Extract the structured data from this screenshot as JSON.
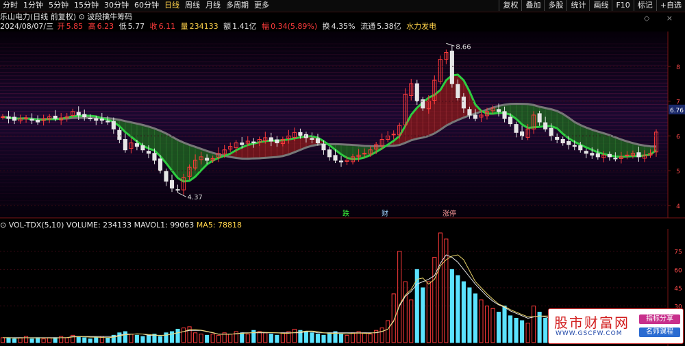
{
  "toolbar": {
    "tabs": [
      "分时",
      "1分钟",
      "5分钟",
      "15分钟",
      "30分钟",
      "60分钟",
      "日线",
      "周线",
      "月线",
      "多周期",
      "更多"
    ],
    "active_index": 6,
    "right_buttons": [
      "复权",
      "叠加",
      "多股",
      "统计",
      "画线",
      "F10",
      "标记",
      "+自选"
    ]
  },
  "header": {
    "stock_title": "乐山电力(日线 前复权)",
    "indicator_name": "波段擒牛筹码"
  },
  "quote": {
    "date": "2024/08/07/三",
    "open_label": "开",
    "open": "5.85",
    "high_label": "高",
    "high": "6.23",
    "low_label": "低",
    "low": "5.77",
    "close_label": "收",
    "close": "6.11",
    "volume_label": "量",
    "volume": "234133",
    "amount_label": "额",
    "amount": "1.41亿",
    "change_label": "幅",
    "change": "0.34(5.89%)",
    "turnover_label": "换",
    "turnover": "4.35%",
    "float_label": "流通",
    "float_value": "5.38亿",
    "sector": "水力发电"
  },
  "volume_header": {
    "name": "VOL-TDX(5,10)",
    "volume": "VOLUME: 234133",
    "mavol1": "MAVOL1: 99063",
    "ma5": "MA5: 78818"
  },
  "annotations": {
    "high_label": "8.66",
    "low_label": "4.37",
    "current_price_tag": "6.76",
    "events": [
      "跌",
      "财",
      "涨停"
    ]
  },
  "price_axis_ticks": [
    "8",
    "7",
    "6",
    "5",
    "4"
  ],
  "volume_axis_ticks": [
    "75",
    "60",
    "45",
    "30"
  ],
  "watermark": {
    "site": "股市财富网",
    "url": "WWW.GSCFW.COM",
    "tag1": "指标分享",
    "tag2": "名师课程"
  },
  "colors": {
    "up": "#ff3b3b",
    "down": "#5be3ff",
    "green_band": "#2ecc40",
    "red_band": "#d93030",
    "ma_yellow": "#e8d36a",
    "ma_white": "#e6e6e6"
  },
  "chart_data": {
    "type": "candlestick",
    "price_range": [
      4.0,
      9.0
    ],
    "high": 8.66,
    "low": 4.37,
    "last_close": 6.11,
    "close_series": [
      6.55,
      6.5,
      6.45,
      6.5,
      6.52,
      6.45,
      6.4,
      6.5,
      6.55,
      6.5,
      6.52,
      6.55,
      6.7,
      6.6,
      6.55,
      6.5,
      6.45,
      6.45,
      6.4,
      6.2,
      5.9,
      5.6,
      5.8,
      5.7,
      5.6,
      5.5,
      5.3,
      5.0,
      4.7,
      4.5,
      4.45,
      4.8,
      5.1,
      5.3,
      5.4,
      5.3,
      5.35,
      5.5,
      5.6,
      5.7,
      5.8,
      5.75,
      5.85,
      5.8,
      5.9,
      5.95,
      5.85,
      5.8,
      5.9,
      6.0,
      6.1,
      6.0,
      5.95,
      5.9,
      5.8,
      5.6,
      5.4,
      5.3,
      5.25,
      5.3,
      5.4,
      5.45,
      5.5,
      5.6,
      5.75,
      5.9,
      6.0,
      6.05,
      6.3,
      7.2,
      7.5,
      7.0,
      6.8,
      7.0,
      7.6,
      8.2,
      8.4,
      7.5,
      7.1,
      6.8,
      6.6,
      6.5,
      6.6,
      6.7,
      6.8,
      6.7,
      6.5,
      6.35,
      6.1,
      6.0,
      6.2,
      6.6,
      6.4,
      6.2,
      6.0,
      5.9,
      5.8,
      5.75,
      5.7,
      5.6,
      5.5,
      5.45,
      5.4,
      5.45,
      5.4,
      5.35,
      5.4,
      5.45,
      5.5,
      5.4,
      5.45,
      5.5,
      6.11
    ],
    "volume_series_wan": [
      4,
      4,
      3,
      4,
      5,
      3,
      4,
      3,
      4,
      4,
      5,
      4,
      6,
      5,
      4,
      3,
      4,
      5,
      4,
      6,
      8,
      9,
      7,
      6,
      5,
      6,
      7,
      5,
      8,
      9,
      11,
      12,
      13,
      8,
      7,
      6,
      7,
      6,
      8,
      7,
      9,
      8,
      7,
      10,
      9,
      8,
      7,
      6,
      8,
      9,
      11,
      10,
      9,
      8,
      7,
      6,
      8,
      9,
      7,
      6,
      8,
      9,
      8,
      7,
      10,
      12,
      18,
      40,
      75,
      50,
      35,
      60,
      45,
      50,
      70,
      90,
      85,
      60,
      55,
      50,
      45,
      40,
      35,
      30,
      28,
      25,
      30,
      22,
      20,
      18,
      16,
      30,
      25,
      20,
      18,
      15,
      14,
      12,
      13,
      11,
      10,
      12,
      11,
      10,
      9,
      8,
      9,
      10,
      11,
      9,
      10,
      12,
      23
    ],
    "mavol_series_wan": [
      4,
      4,
      4,
      4,
      4,
      4,
      4,
      4,
      4,
      4,
      4,
      4,
      5,
      5,
      5,
      5,
      5,
      5,
      5,
      5,
      6,
      7,
      7,
      7,
      7,
      6,
      6,
      6,
      6,
      7,
      8,
      9,
      10,
      10,
      10,
      9,
      8,
      7,
      7,
      7,
      7,
      8,
      8,
      8,
      8,
      8,
      8,
      8,
      8,
      8,
      8,
      8,
      9,
      9,
      8,
      8,
      8,
      8,
      8,
      8,
      8,
      8,
      8,
      8,
      8,
      9,
      11,
      18,
      30,
      38,
      42,
      48,
      50,
      52,
      55,
      65,
      72,
      70,
      66,
      60,
      54,
      48,
      43,
      38,
      34,
      31,
      29,
      26,
      24,
      22,
      20,
      21,
      22,
      21,
      20,
      18,
      16,
      14,
      13,
      12,
      12,
      12,
      11,
      11,
      10,
      10,
      10,
      10,
      10,
      10,
      10,
      10,
      11
    ]
  }
}
